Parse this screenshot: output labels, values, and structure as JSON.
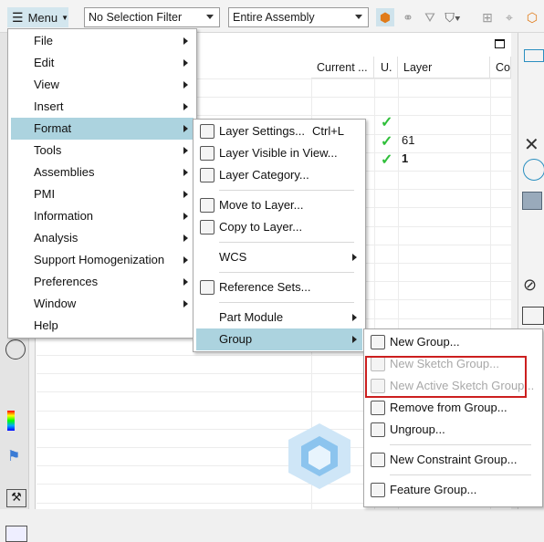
{
  "toolbar": {
    "menu_label": "Menu",
    "selection_filter": "No Selection Filter",
    "scope": "Entire Assembly",
    "icons": [
      "assembly-select-icon",
      "link-icon",
      "filter-icon",
      "type-filter-icon",
      "snap-icon",
      "point-icon",
      "add-component-icon"
    ]
  },
  "table": {
    "columns": [
      "Current ...",
      "U.",
      "Layer",
      "Co"
    ],
    "rows": [
      {
        "check": "✓",
        "layer": ""
      },
      {
        "check": "✓",
        "layer": "61"
      },
      {
        "check": "✓",
        "layer": "1"
      }
    ]
  },
  "main_menu": [
    {
      "label": "File",
      "u": 0
    },
    {
      "label": "Edit",
      "u": 0
    },
    {
      "label": "View",
      "u": 0
    },
    {
      "label": "Insert",
      "u": 1
    },
    {
      "label": "Format",
      "u": 1
    },
    {
      "label": "Tools",
      "u": 0
    },
    {
      "label": "Assemblies",
      "u": 0
    },
    {
      "label": "PMI",
      "u": 1
    },
    {
      "label": "Information",
      "u": 0
    },
    {
      "label": "Analysis",
      "u": 1
    },
    {
      "label": "Support Homogenization",
      "u": 0
    },
    {
      "label": "Preferences",
      "u": 0
    },
    {
      "label": "Window",
      "u": 0
    },
    {
      "label": "Help",
      "u": 0
    }
  ],
  "main_menu_active": "Format",
  "format_menu": [
    {
      "label": "Layer Settings...",
      "u": 6,
      "shortcut": "Ctrl+L",
      "icon": "layer-settings-icon"
    },
    {
      "label": "Layer Visible in View...",
      "u": 6,
      "icon": "layer-visible-icon"
    },
    {
      "label": "Layer Category...",
      "u": 6,
      "icon": "layer-category-icon",
      "sep": true
    },
    {
      "label": "Move to Layer...",
      "u": 0,
      "icon": "move-to-layer-icon"
    },
    {
      "label": "Copy to Layer...",
      "u": 1,
      "icon": "copy-to-layer-icon",
      "sep": true
    },
    {
      "label": "WCS",
      "u": 0,
      "submenu": true,
      "sep": true
    },
    {
      "label": "Reference Sets...",
      "u": 0,
      "icon": "reference-sets-icon",
      "sep": true
    },
    {
      "label": "Part Module",
      "u": 7,
      "submenu": true
    },
    {
      "label": "Group",
      "u": 0,
      "submenu": true,
      "active": true
    }
  ],
  "group_menu": [
    {
      "label": "New Group...",
      "u": 0,
      "icon": "new-group-icon"
    },
    {
      "label": "New Sketch Group...",
      "u": 5,
      "icon": "new-sketch-group-icon",
      "disabled": true
    },
    {
      "label": "New Active Sketch Group...",
      "u": 13,
      "icon": "new-active-sketch-group-icon",
      "disabled": true
    },
    {
      "label": "Remove from Group...",
      "u": 0,
      "icon": "remove-from-group-icon"
    },
    {
      "label": "Ungroup...",
      "u": 0,
      "icon": "ungroup-icon",
      "sep": true
    },
    {
      "label": "New Constraint Group...",
      "u": 4,
      "icon": "new-constraint-group-icon",
      "sep": true
    },
    {
      "label": "Feature Group...",
      "u": 0,
      "icon": "feature-group-icon"
    }
  ],
  "colors": {
    "highlight": "#acd3df",
    "annotation_box": "#cc1f1f",
    "check": "#2fbf3a"
  }
}
